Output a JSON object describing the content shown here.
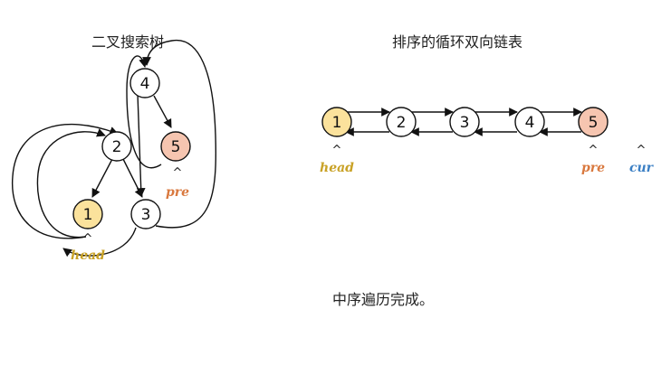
{
  "tree": {
    "title": "二叉搜索树",
    "nodes": {
      "n4": "4",
      "n2": "2",
      "n5": "5",
      "n1": "1",
      "n3": "3"
    },
    "labels": {
      "pre": "pre",
      "head": "head"
    },
    "caret": "^"
  },
  "list": {
    "title": "排序的循环双向链表",
    "nodes": [
      "1",
      "2",
      "3",
      "4",
      "5"
    ],
    "labels": {
      "head": "head",
      "pre": "pre",
      "cur": "cur"
    },
    "caret": "^"
  },
  "status": "中序遍历完成。",
  "colors": {
    "head_fill": "#fbe29c",
    "pre_fill": "#f6c5b0",
    "head_text": "#c9a227",
    "pre_text": "#d9793f",
    "cur_text": "#3b7fc4"
  }
}
